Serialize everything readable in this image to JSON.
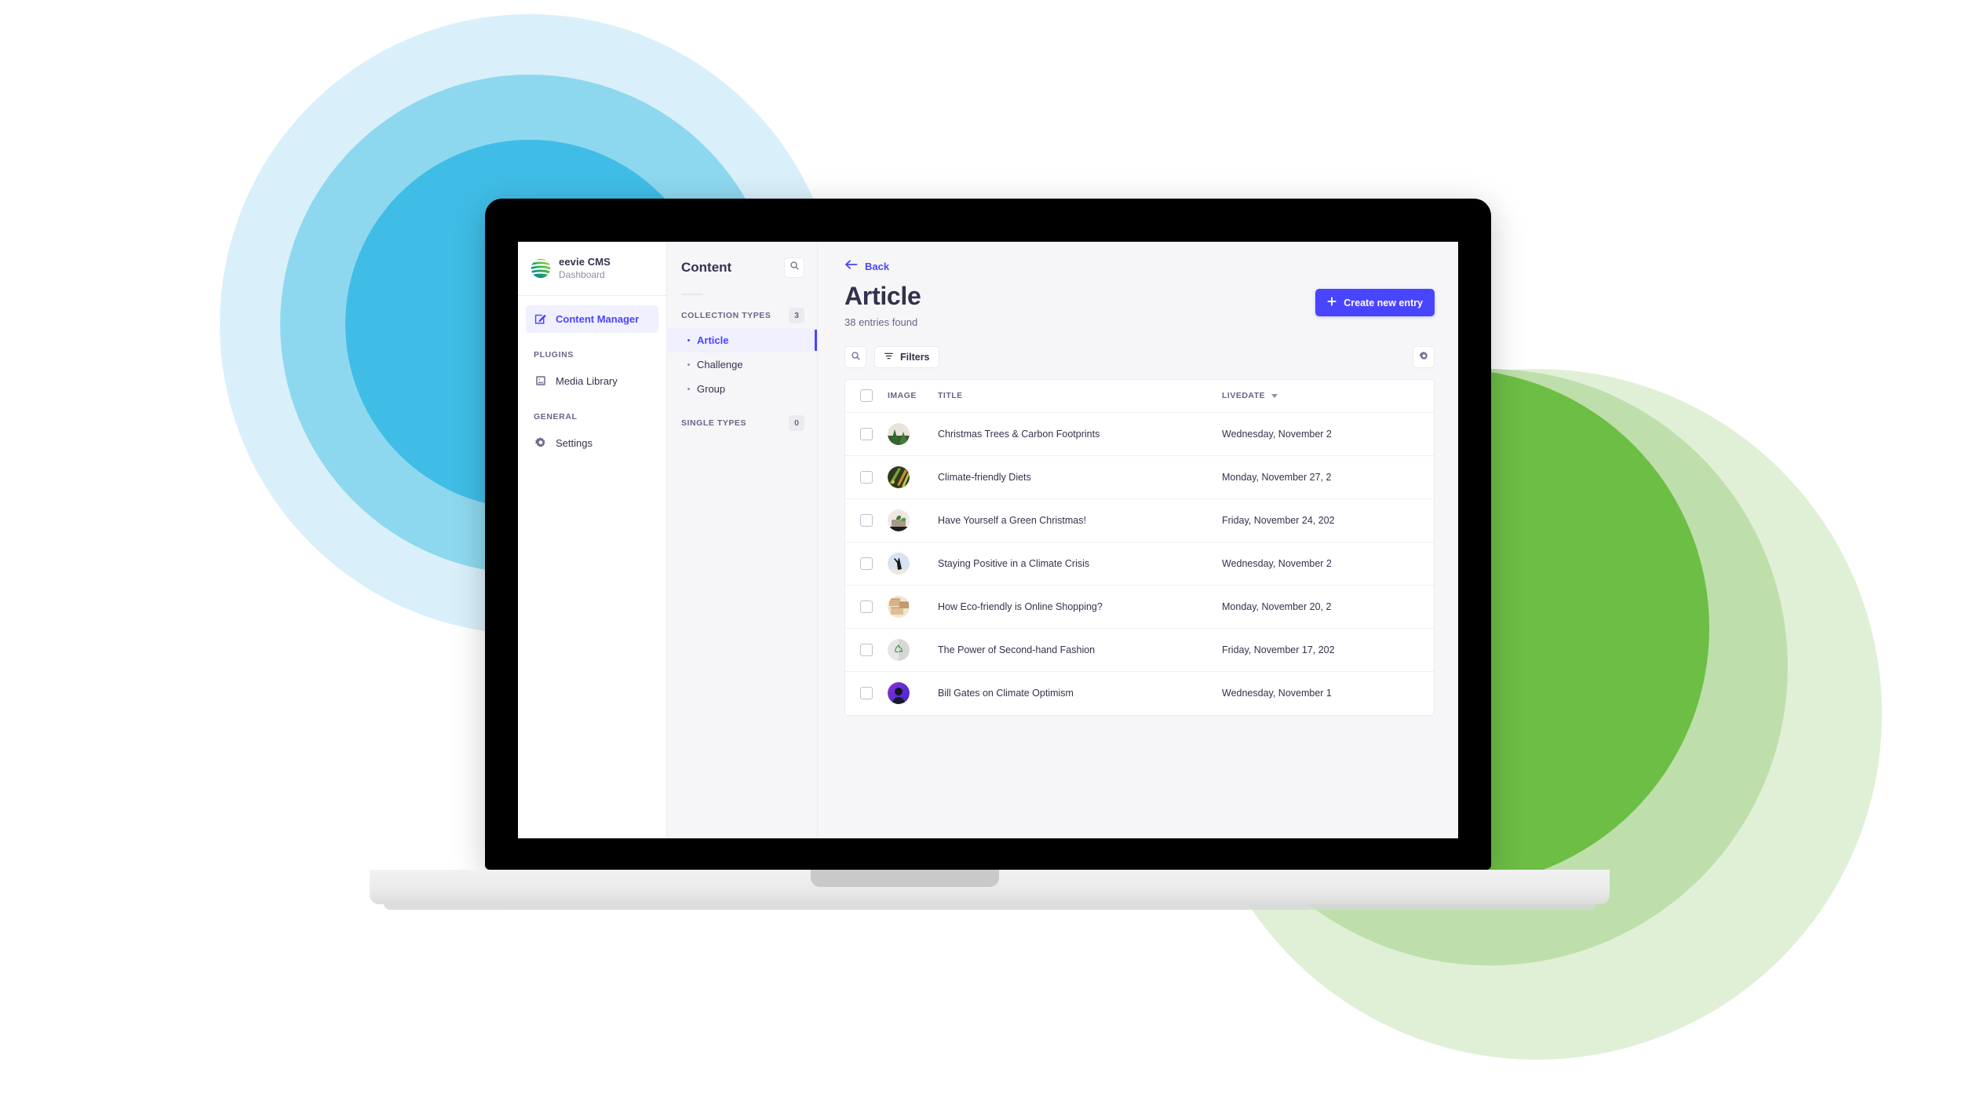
{
  "brand": {
    "name": "eevie CMS",
    "subtitle": "Dashboard",
    "logo_icon": "eevie-globe-logo"
  },
  "sidebar": {
    "primary": [
      {
        "label": "Content Manager",
        "icon": "pencil-square-icon",
        "active": true
      }
    ],
    "groups": [
      {
        "title": "PLUGINS",
        "items": [
          {
            "label": "Media Library",
            "icon": "image-icon"
          }
        ]
      },
      {
        "title": "GENERAL",
        "items": [
          {
            "label": "Settings",
            "icon": "gear-icon"
          }
        ]
      }
    ]
  },
  "content_panel": {
    "title": "Content",
    "search_icon": "search-icon",
    "collection_types": {
      "label": "COLLECTION TYPES",
      "count": "3",
      "items": [
        {
          "label": "Article",
          "active": true
        },
        {
          "label": "Challenge",
          "active": false
        },
        {
          "label": "Group",
          "active": false
        }
      ]
    },
    "single_types": {
      "label": "SINGLE TYPES",
      "count": "0"
    }
  },
  "main": {
    "back_label": "Back",
    "back_icon": "arrow-left-icon",
    "page_title": "Article",
    "entries_found": "38 entries found",
    "create_button": {
      "label": "Create new entry",
      "icon": "plus-icon"
    },
    "toolbar": {
      "search_icon": "search-icon",
      "filters_label": "Filters",
      "filters_icon": "filter-icon",
      "settings_icon": "gear-icon"
    },
    "table": {
      "columns": [
        "IMAGE",
        "TITLE",
        "LIVEDATE"
      ],
      "sort_column": "LIVEDATE",
      "sort_icon": "caret-down-icon",
      "rows": [
        {
          "image": "christmas-trees-thumb",
          "title": "Christmas Trees & Carbon Footprints",
          "livedate": "Wednesday, November 2"
        },
        {
          "image": "vegetables-thumb",
          "title": "Climate-friendly Diets",
          "livedate": "Monday, November 27, 2"
        },
        {
          "image": "gift-plant-thumb",
          "title": "Have Yourself a Green Christmas!",
          "livedate": "Friday, November 24, 202"
        },
        {
          "image": "person-arms-raised-thumb",
          "title": "Staying Positive in a Climate Crisis",
          "livedate": "Wednesday, November 2"
        },
        {
          "image": "cardboard-boxes-thumb",
          "title": "How Eco-friendly is Online Shopping?",
          "livedate": "Monday, November 20, 2"
        },
        {
          "image": "recycle-symbol-thumb",
          "title": "The Power of Second-hand Fashion",
          "livedate": "Friday, November 17, 202"
        },
        {
          "image": "purple-portrait-thumb",
          "title": "Bill Gates on Climate Optimism",
          "livedate": "Wednesday, November 1"
        }
      ]
    }
  },
  "colors": {
    "accent": "#4945ff",
    "accent_bg": "#f0f0ff",
    "text": "#32324d",
    "muted": "#666687",
    "app_bg": "#f6f6f9",
    "blue_outer": "#d9f0fa",
    "blue_mid": "#8ed8ef",
    "blue_inner": "#3fbde6",
    "green_outer": "#e0f0d6",
    "green_mid": "#bedfab",
    "green_inner": "#6cbe45"
  }
}
